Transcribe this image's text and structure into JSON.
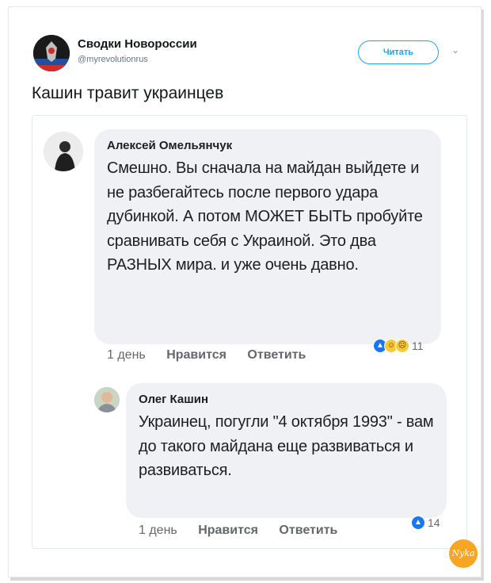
{
  "tweet": {
    "author_name": "Сводки Новороссии",
    "handle": "@myrevolutionrus",
    "follow_label": "Читать",
    "text": "Кашин травит украинцев"
  },
  "comments": [
    {
      "author": "Алексей Омельянчук",
      "text": "Смешно. Вы сначала на майдан выйдете и не разбегайтесь после первого удара дубинкой. А потом МОЖЕТ БЫТЬ пробуйте сравнивать себя с Украиной. Это два РАЗНЫХ мира. и уже очень давно.",
      "time": "1 день",
      "like_label": "Нравится",
      "reply_label": "Ответить",
      "reactions_count": "11"
    },
    {
      "author": "Олег Кашин",
      "text": "Украинец, погугли \"4 октября 1993\" - вам до такого майдана еще развиваться и развиваться.",
      "time": "1 день",
      "like_label": "Нравится",
      "reply_label": "Ответить",
      "reactions_count": "14"
    }
  ],
  "colors": {
    "twitter_blue": "#1da1f2",
    "fb_like_blue": "#1877f2",
    "bubble_gray": "#f0f1f4"
  },
  "watermark": "Nyka"
}
